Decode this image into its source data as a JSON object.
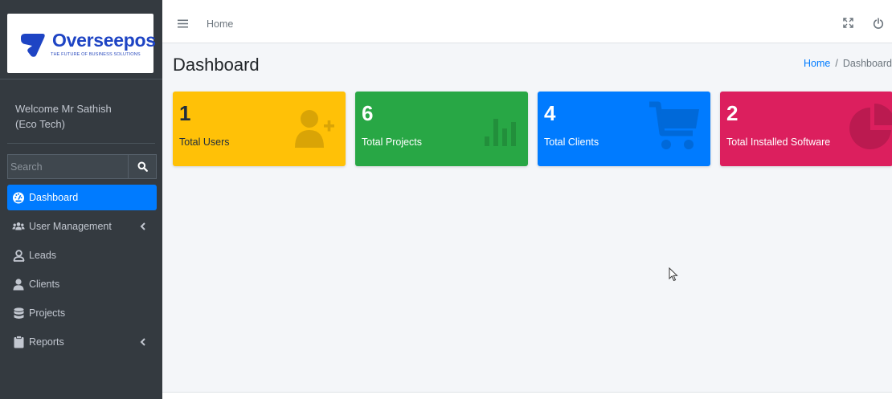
{
  "brand": {
    "name": "Overseepos",
    "tagline": "THE FUTURE OF BUSINESS SOLUTIONS"
  },
  "user": {
    "line1": "Welcome Mr Sathish",
    "line2": "(Eco Tech)"
  },
  "search": {
    "placeholder": "Search",
    "icon": "search-icon"
  },
  "sidebar": {
    "items": [
      {
        "label": "Dashboard",
        "icon": "tachometer-icon",
        "active": true
      },
      {
        "label": "User Management",
        "icon": "users-icon",
        "caret": true
      },
      {
        "label": "Leads",
        "icon": "user-tie-icon"
      },
      {
        "label": "Clients",
        "icon": "user-icon"
      },
      {
        "label": "Projects",
        "icon": "database-icon"
      },
      {
        "label": "Reports",
        "icon": "clipboard-icon",
        "caret": true
      }
    ]
  },
  "topbar": {
    "home_label": "Home"
  },
  "header": {
    "title": "Dashboard",
    "breadcrumb": [
      "Home",
      "Dashboard"
    ]
  },
  "boxes": [
    {
      "value": "1",
      "label": "Total Users",
      "color": "#ffc107",
      "icon": "user-plus-icon"
    },
    {
      "value": "6",
      "label": "Total Projects",
      "color": "#28a745",
      "icon": "bar-chart-icon"
    },
    {
      "value": "4",
      "label": "Total Clients",
      "color": "#007bff",
      "icon": "shopping-cart-icon"
    },
    {
      "value": "2",
      "label": "Total Installed Software",
      "color": "#dc1f5e",
      "icon": "pie-chart-icon"
    }
  ],
  "colors": {
    "sidebar_bg": "#343a40",
    "accent": "#007bff",
    "content_bg": "#f4f6f9"
  }
}
